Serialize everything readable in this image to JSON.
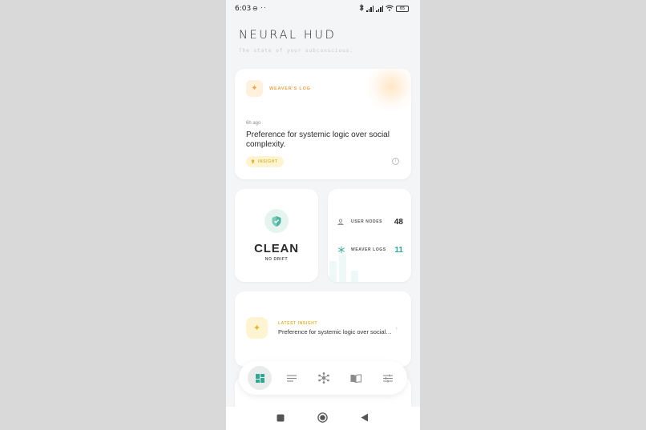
{
  "status_bar": {
    "time": "6:03",
    "battery": "65",
    "icons": [
      "do-not-disturb-icon",
      "bluetooth-icon",
      "signal-icon",
      "signal-icon",
      "wifi-icon",
      "battery-icon"
    ]
  },
  "header": {
    "title": "NEURAL HUD",
    "subtitle": "The state of your subconscious."
  },
  "weaver_card": {
    "label": "WEAVER'S LOG",
    "time_ago": "6h ago",
    "text": "Preference for systemic logic over social complexity.",
    "badge": "INSIGHT",
    "accent": "#f0a34a"
  },
  "status_card": {
    "status": "CLEAN",
    "substatus": "NO DRIFT",
    "accent": "#4fb3a1"
  },
  "stats_card": {
    "user_nodes_label": "USER NODES",
    "user_nodes_value": "48",
    "weaver_logs_label": "WEAVER LOGS",
    "weaver_logs_value": "11",
    "weaver_logs_color": "#2ea895"
  },
  "latest_insight": {
    "label": "LATEST INSIGHT",
    "text": "Preference for systemic logic over social complexity."
  },
  "bottom_nav": {
    "items": [
      "dashboard-icon",
      "list-icon",
      "network-icon",
      "book-icon",
      "sliders-icon"
    ],
    "active": "dashboard-icon",
    "active_color": "#2ea895"
  },
  "system_nav": [
    "recents-icon",
    "home-icon",
    "back-icon"
  ]
}
